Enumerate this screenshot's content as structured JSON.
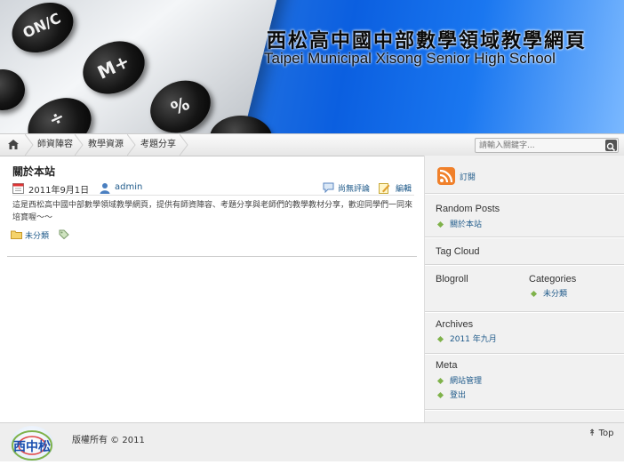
{
  "header": {
    "title_zh": "西松高中國中部數學領域教學網頁",
    "title_en": "Taipei Municipal Xisong Senior High School",
    "calculator_keys": [
      "ON/C",
      "M+",
      "%",
      "÷"
    ]
  },
  "nav": {
    "items": [
      "師資陣容",
      "教學資源",
      "考題分享"
    ],
    "search_placeholder": "請輸入關鍵字..."
  },
  "post": {
    "title": "關於本站",
    "date": "2011年9月1日",
    "author": "admin",
    "comments": "尚無評論",
    "edit": "編輯",
    "body": "這是西松高中國中部數學領域教學網頁，提供有師資陣容、考題分享與老師們的教學教材分享，歡迎同學們一同來培寶喔～～",
    "category": "未分類"
  },
  "sidebar": {
    "subscribe": "訂閱",
    "random_posts": {
      "title": "Random Posts",
      "items": [
        "關於本站"
      ]
    },
    "tag_cloud": {
      "title": "Tag Cloud"
    },
    "blogroll": {
      "title": "Blogroll"
    },
    "categories": {
      "title": "Categories",
      "items": [
        "未分類"
      ]
    },
    "archives": {
      "title": "Archives",
      "items": [
        "2011 年九月"
      ]
    },
    "meta": {
      "title": "Meta",
      "items": [
        "網站管理",
        "登出"
      ]
    }
  },
  "footer": {
    "copyright": "版權所有 © 2011",
    "top": "Top",
    "logo_text": "西中松"
  },
  "colors": {
    "banner_blue": "#0b5fe0",
    "link": "#1f5a8a",
    "bullet_green": "#7fb24a",
    "rss_orange": "#f0802a"
  }
}
